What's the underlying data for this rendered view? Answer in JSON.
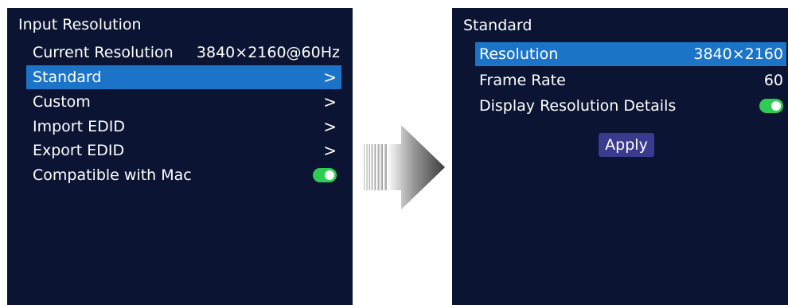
{
  "left_panel": {
    "title": "Input Resolution",
    "items": [
      {
        "label": "Current Resolution",
        "value": "3840×2160@60Hz"
      },
      {
        "label": "Standard",
        "chevron": ">"
      },
      {
        "label": "Custom",
        "chevron": ">"
      },
      {
        "label": "Import EDID",
        "chevron": ">"
      },
      {
        "label": "Export EDID",
        "chevron": ">"
      },
      {
        "label": "Compatible with Mac",
        "toggle": true
      }
    ],
    "selected_index": 1
  },
  "right_panel": {
    "title": "Standard",
    "items": [
      {
        "label": "Resolution",
        "value": "3840×2160"
      },
      {
        "label": "Frame Rate",
        "value": "60"
      },
      {
        "label": "Display Resolution Details",
        "toggle": true
      }
    ],
    "selected_index": 0,
    "apply_label": "Apply"
  },
  "colors": {
    "screen_bg": "#0b1533",
    "selection": "#1b74c8",
    "toggle_on": "#2ecc52",
    "apply_button": "#3a3a8f"
  },
  "icons": {
    "arrow": "right-arrow-icon"
  }
}
